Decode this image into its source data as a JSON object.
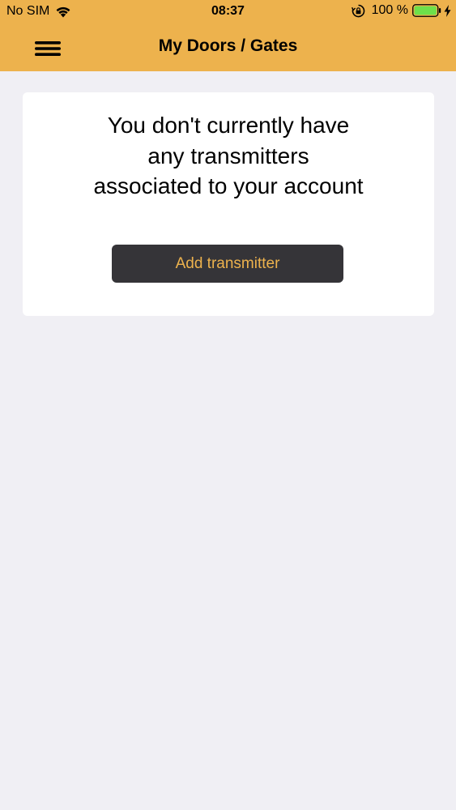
{
  "status_bar": {
    "carrier": "No SIM",
    "time": "08:37",
    "battery_percent": "100 %",
    "icons": [
      "wifi-icon",
      "lock-rotation-icon",
      "battery-icon",
      "charging-icon"
    ]
  },
  "nav": {
    "title": "My Doors / Gates",
    "menu_icon": "hamburger-menu-icon"
  },
  "card": {
    "message": "You don't currently have any transmitters associated to your account",
    "button_label": "Add transmitter"
  },
  "colors": {
    "header_bg": "#edb24d",
    "page_bg": "#f0eff4",
    "card_bg": "#ffffff",
    "button_bg": "#353438",
    "button_text": "#edb24d",
    "battery_fill": "#6ee04a"
  }
}
